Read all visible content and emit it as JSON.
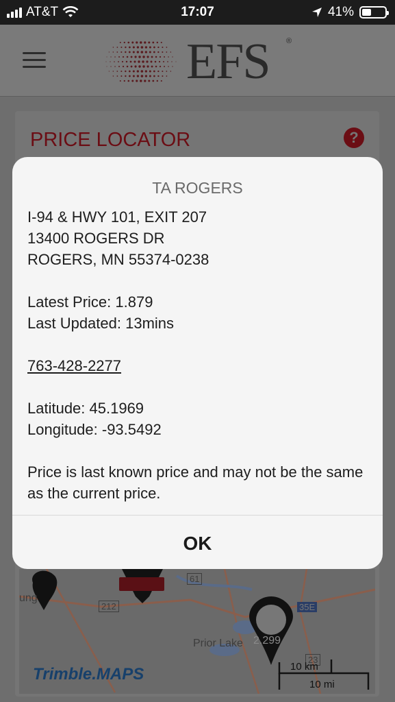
{
  "status_bar": {
    "carrier": "AT&T",
    "time": "17:07",
    "battery_percent": "41%",
    "battery_level": 0.41
  },
  "header": {
    "brand": "EFS",
    "registered_mark": "®"
  },
  "page": {
    "title": "PRICE LOCATOR",
    "help_glyph": "?"
  },
  "map": {
    "place_label": "Prior Lake",
    "partial_label": "ung",
    "price_label": "2.299",
    "highway_1": "61",
    "highway_2": "212",
    "highway_3": "35E",
    "highway_4": "23",
    "scale_km": "10 km",
    "scale_mi": "10 mi",
    "attribution": "Trimble.MAPS"
  },
  "dialog": {
    "station_name": "TA ROGERS",
    "address_line_1": "I-94 & HWY 101, EXIT 207",
    "address_line_2": "13400 ROGERS DR",
    "address_line_3": "ROGERS, MN 55374-0238",
    "latest_price": "Latest Price: 1.879",
    "last_updated": "Last Updated: 13mins",
    "phone": "763-428-2277",
    "latitude": "Latitude: 45.1969",
    "longitude": "Longitude: -93.5492",
    "disclaimer": "Price is last known price and may not be the same as the current price.",
    "ok_label": "OK"
  },
  "colors": {
    "brand_red": "#a5121e",
    "overlay": "#6e6e6e",
    "dialog_bg": "#f5f5f5"
  }
}
